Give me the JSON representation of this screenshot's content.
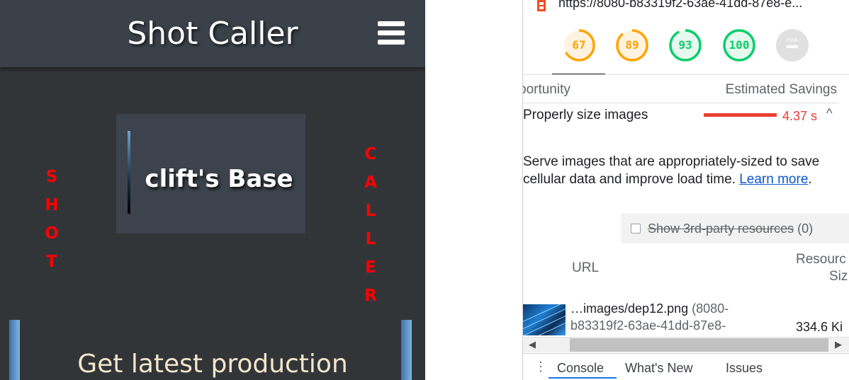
{
  "preview": {
    "site_title": "Shot Caller",
    "menu_icon": "hamburger-menu-icon",
    "base_card_label": "clift's Base",
    "left_vertical_letters": [
      "S",
      "H",
      "O",
      "T"
    ],
    "right_vertical_letters": [
      "C",
      "A",
      "L",
      "L",
      "E",
      "R"
    ],
    "section_heading": "Get latest production",
    "colors": {
      "header_bg": "#3a4149",
      "page_bg": "#323538",
      "vertical_text": "#ff0000",
      "heading_text": "#f3e6cb"
    }
  },
  "devtools": {
    "lighthouse_icon": "lighthouse-icon",
    "report_url": "https://8080-b83319f2-63ae-41dd-87e8-e...",
    "scores": [
      {
        "value": "67",
        "score": 0.67,
        "color": "#ffa400",
        "bg": "#fff3e0"
      },
      {
        "value": "89",
        "score": 0.89,
        "color": "#ffa400",
        "bg": "#fff3e0"
      },
      {
        "value": "93",
        "score": 0.93,
        "color": "#0cce6b",
        "bg": "#e6f9ee"
      },
      {
        "value": "100",
        "score": 1.0,
        "color": "#0cce6b",
        "bg": "#e6f9ee"
      }
    ],
    "pwa_badge": {
      "label": "PWA",
      "icon": "pwa-badge-icon",
      "color": "#e0e0e0"
    },
    "opportunity_header": {
      "left": "portunity",
      "right": "Estimated Savings"
    },
    "audit": {
      "title": "Properly size images",
      "savings": "4.37 s",
      "bar_color": "#eb3d33",
      "expand_icon": "chevron-up-icon"
    },
    "description": {
      "text": "Serve images that are appropriately-sized to save cellular data and improve load time. ",
      "link": "Learn more",
      "suffix": "."
    },
    "third_party": {
      "label": "Show 3rd-party resources",
      "count": "(0)",
      "checked": false
    },
    "table": {
      "col_url": "URL",
      "col_resource_line1": "Resourc",
      "col_resource_line2": "Siz",
      "rows": [
        {
          "file": "…images/dep12.png",
          "host_line1": "(8080-",
          "host_line2": "b83319f2-63ae-41dd-87e8-",
          "size": "334.6 Ki"
        }
      ]
    },
    "drawer_tabs": [
      {
        "label": "Console",
        "active": true
      },
      {
        "label": "What's New",
        "active": false
      },
      {
        "label": "Issues",
        "active": false
      }
    ],
    "drawer_menu_icon": "more-vertical-icon"
  }
}
